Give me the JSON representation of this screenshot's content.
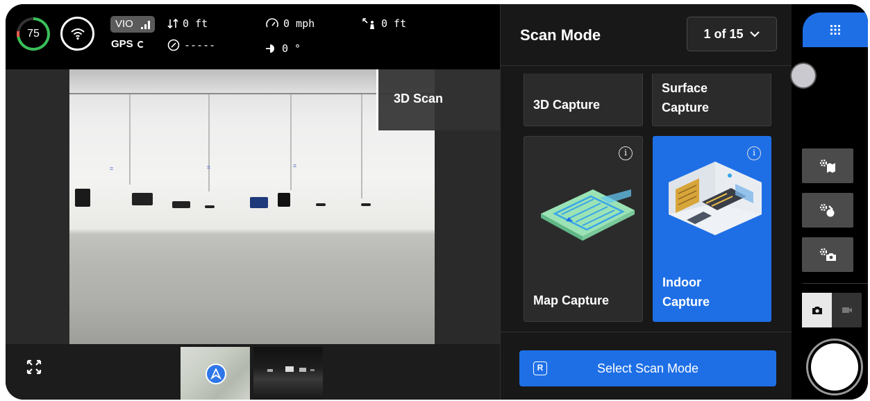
{
  "telemetry": {
    "battery_pct": "75",
    "vio_label": "VIO",
    "gps_label": "GPS",
    "vertical": "0 ft",
    "heading_value": "-----",
    "speed": "0 mph",
    "gimbal_angle": "0 °",
    "distance": "0 ft"
  },
  "camera": {
    "overlay_label": "3D Scan"
  },
  "panel": {
    "title": "Scan Mode",
    "page_indicator": "1 of 15",
    "cards": [
      {
        "label": "3D Capture",
        "selected": false
      },
      {
        "label_lines": [
          "Surface",
          "Capture"
        ],
        "selected": false
      },
      {
        "label": "Map Capture",
        "has_info": true,
        "selected": false
      },
      {
        "label_lines": [
          "Indoor",
          "Capture"
        ],
        "has_info": true,
        "selected": true
      }
    ],
    "select_button": {
      "key": "R",
      "label": "Select Scan Mode"
    }
  },
  "rail": {
    "capture_mode": "photo"
  },
  "colors": {
    "accent": "#1e6fe6",
    "panel_bg": "#181818",
    "card_bg": "#2b2b2b"
  }
}
